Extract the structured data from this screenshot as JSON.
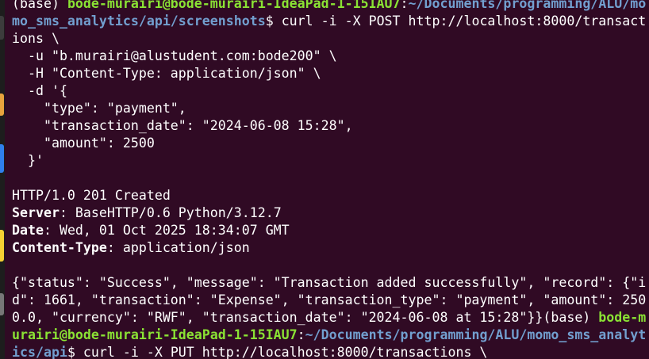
{
  "colors": {
    "background": "#300a24",
    "foreground": "#ffffff",
    "user_host": "#8ae234",
    "path": "#729fcf"
  },
  "dock": {
    "icons": [
      "terminal-icon",
      "files-icon",
      "code-icon",
      "browser-icon",
      "trash-icon"
    ]
  },
  "terminal": {
    "prompt1": {
      "env": "(base) ",
      "user_host": "bode-murairi@bode-murairi-IdeaPad-1-15IAU7",
      "sep": ":",
      "path_part1": "~/Documents/programming/ALU/mo",
      "path_part2": "mo_sms_analytics/api/screenshots",
      "symbol": "$ ",
      "cmd_part1": "curl -i -X POST http://localhost:8000/transact",
      "cmd_part2": "ions \\"
    },
    "cmd_lines": [
      "  -u \"b.murairi@alustudent.com:bode200\" \\",
      "  -H \"Content-Type: application/json\" \\",
      "  -d '{",
      "    \"type\": \"payment\",",
      "    \"transaction_date\": \"2024-06-08 15:28\",",
      "    \"amount\": 2500",
      "  }'"
    ],
    "status_line": "HTTP/1.0 201 Created",
    "headers": [
      {
        "key": "Server",
        "value": ": BaseHTTP/0.6 Python/3.12.7"
      },
      {
        "key": "Date",
        "value": ": Wed, 01 Oct 2025 18:34:07 GMT"
      },
      {
        "key": "Content-Type",
        "value": ": application/json"
      }
    ],
    "body_lines": [
      "{\"status\": \"Success\", \"message\": \"Transaction added successfully\", \"record\": {\"i",
      "d\": 1661, \"transaction\": \"Expense\", \"transaction_type\": \"payment\", \"amount\": 250"
    ],
    "body_last": "0.0, \"currency\": \"RWF\", \"transaction_date\": \"2024-06-08 at 15:28\"}}",
    "prompt2": {
      "env": "(base) ",
      "user_host_part1": "bode-m",
      "user_host_part2": "urairi@bode-murairi-IdeaPad-1-15IAU7",
      "sep": ":",
      "path_part1": "~/Documents/programming/ALU/momo_sms_analyt",
      "path_part2": "ics/api",
      "symbol": "$ ",
      "cmd": "curl -i -X PUT http://localhost:8000/transactions \\"
    }
  }
}
